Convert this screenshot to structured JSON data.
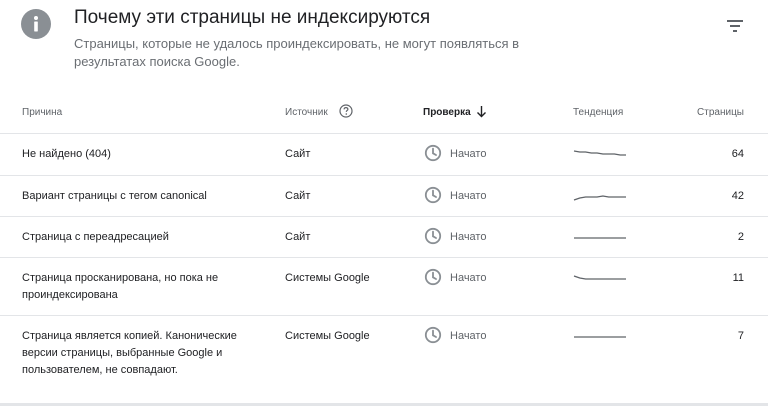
{
  "header": {
    "info_icon": "info-icon",
    "title": "Почему эти страницы не индексируются",
    "subtitle": "Страницы, которые не удалось проиндексировать, не могут появляться в результатах поиска Google.",
    "filter_icon": "filter-icon"
  },
  "table": {
    "columns": {
      "reason": "Причина",
      "source": "Источник",
      "check": "Проверка",
      "trend": "Тенденция",
      "pages": "Страницы"
    },
    "sort": {
      "column": "check",
      "direction": "descending"
    },
    "rows": [
      {
        "reason": "Не найдено (404)",
        "source": "Сайт",
        "status": "Начато",
        "trend": [
          8,
          9,
          9,
          10,
          10,
          11,
          11,
          11,
          12,
          12
        ],
        "pages": "64"
      },
      {
        "reason": "Вариант страницы с тегом canonical",
        "source": "Сайт",
        "status": "Начато",
        "trend": [
          15,
          13,
          12,
          12,
          12,
          11,
          12,
          12,
          12,
          12
        ],
        "pages": "42"
      },
      {
        "reason": "Страница с переадресацией",
        "source": "Сайт",
        "status": "Начато",
        "trend": [
          12,
          12,
          12,
          12,
          12,
          12,
          12,
          12,
          12,
          12
        ],
        "pages": "2"
      },
      {
        "reason": "Страница просканирована, но пока не проиндексирована",
        "source": "Системы Google",
        "status": "Начато",
        "trend": [
          9,
          11,
          12,
          12,
          12,
          12,
          12,
          12,
          12,
          12
        ],
        "pages": "11"
      },
      {
        "reason": "Страница является копией. Канонические версии страницы, выбранные Google и пользователем, не совпадают.",
        "source": "Системы Google",
        "status": "Начато",
        "trend": [
          12,
          12,
          12,
          12,
          12,
          12,
          12,
          12,
          12,
          12
        ],
        "pages": "7"
      }
    ]
  },
  "icons": {
    "status": "clock-icon",
    "help": "help-circle-icon",
    "sort": "arrow-down-icon"
  },
  "colors": {
    "icon_gray": "#8a8f94",
    "trend_line": "#5f6368",
    "divider": "#e3e5e8"
  }
}
